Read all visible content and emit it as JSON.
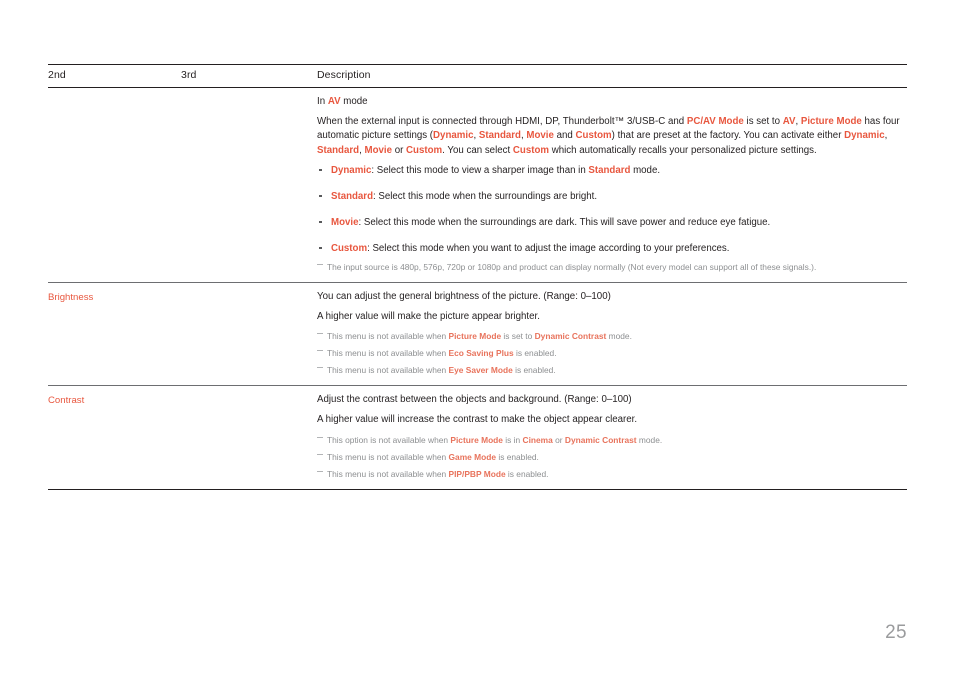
{
  "page": {
    "number": "25",
    "accent_color": "#e8573f",
    "text_color": "#231f20",
    "note_color": "#8d8f91"
  },
  "table": {
    "headers": {
      "col2": "2nd",
      "col3": "3rd",
      "description": "Description"
    },
    "rows": [
      {
        "label_2nd": "",
        "label_3rd": "",
        "paragraphs": [
          {
            "id": "av-mode-heading",
            "runs": [
              {
                "t": "In ",
                "hl": false
              },
              {
                "t": "AV",
                "hl": true
              },
              {
                "t": " mode",
                "hl": false
              }
            ]
          },
          {
            "id": "av-mode-body",
            "runs": [
              {
                "t": "When the external input is connected through HDMI, DP, Thunderbolt™ 3/USB-C and ",
                "hl": false
              },
              {
                "t": "PC/AV Mode",
                "hl": true
              },
              {
                "t": " is set to ",
                "hl": false
              },
              {
                "t": "AV",
                "hl": true
              },
              {
                "t": ", ",
                "hl": false
              },
              {
                "t": "Picture Mode",
                "hl": true
              },
              {
                "t": " has four automatic picture settings (",
                "hl": false
              },
              {
                "t": "Dynamic",
                "hl": true
              },
              {
                "t": ", ",
                "hl": false
              },
              {
                "t": "Standard",
                "hl": true
              },
              {
                "t": ", ",
                "hl": false
              },
              {
                "t": "Movie",
                "hl": true
              },
              {
                "t": " and ",
                "hl": false
              },
              {
                "t": "Custom",
                "hl": true
              },
              {
                "t": ") that are preset at the factory. You can activate either ",
                "hl": false
              },
              {
                "t": "Dynamic",
                "hl": true
              },
              {
                "t": ", ",
                "hl": false
              },
              {
                "t": "Standard",
                "hl": true
              },
              {
                "t": ", ",
                "hl": false
              },
              {
                "t": "Movie",
                "hl": true
              },
              {
                "t": " or ",
                "hl": false
              },
              {
                "t": "Custom",
                "hl": true
              },
              {
                "t": ". You can select ",
                "hl": false
              },
              {
                "t": "Custom",
                "hl": true
              },
              {
                "t": " which automatically recalls your personalized picture settings.",
                "hl": false
              }
            ]
          }
        ],
        "bullets": [
          {
            "runs": [
              {
                "t": "Dynamic",
                "hl": true
              },
              {
                "t": ": Select this mode to view a sharper image than in ",
                "hl": false
              },
              {
                "t": "Standard",
                "hl": true
              },
              {
                "t": " mode.",
                "hl": false
              }
            ]
          },
          {
            "runs": [
              {
                "t": "Standard",
                "hl": true
              },
              {
                "t": ": Select this mode when the surroundings are bright.",
                "hl": false
              }
            ]
          },
          {
            "runs": [
              {
                "t": "Movie",
                "hl": true
              },
              {
                "t": ": Select this mode when the surroundings are dark. This will save power and reduce eye fatigue.",
                "hl": false
              }
            ]
          },
          {
            "runs": [
              {
                "t": "Custom",
                "hl": true
              },
              {
                "t": ": Select this mode when you want to adjust the image according to your preferences.",
                "hl": false
              }
            ]
          }
        ],
        "notes": [
          {
            "runs": [
              {
                "t": "The input source is 480p, 576p, 720p or 1080p and product can display normally (Not every model can support all of these signals.).",
                "hl": false
              }
            ]
          }
        ]
      },
      {
        "label_2nd": "Brightness",
        "label_3rd": "",
        "paragraphs": [
          {
            "id": "brightness-range",
            "runs": [
              {
                "t": "You can adjust the general brightness of the picture. (Range: 0–100)",
                "hl": false
              }
            ]
          },
          {
            "id": "brightness-body",
            "runs": [
              {
                "t": "A higher value will make the picture appear brighter.",
                "hl": false
              }
            ]
          }
        ],
        "bullets": [],
        "notes": [
          {
            "runs": [
              {
                "t": "This menu is not available when ",
                "hl": false
              },
              {
                "t": "Picture Mode",
                "hl": true
              },
              {
                "t": " is set to ",
                "hl": false
              },
              {
                "t": "Dynamic Contrast",
                "hl": true
              },
              {
                "t": " mode.",
                "hl": false
              }
            ]
          },
          {
            "runs": [
              {
                "t": "This menu is not available when ",
                "hl": false
              },
              {
                "t": "Eco Saving Plus",
                "hl": true
              },
              {
                "t": " is enabled.",
                "hl": false
              }
            ]
          },
          {
            "runs": [
              {
                "t": "This menu is not available when ",
                "hl": false
              },
              {
                "t": "Eye Saver Mode",
                "hl": true
              },
              {
                "t": " is enabled.",
                "hl": false
              }
            ]
          }
        ]
      },
      {
        "label_2nd": "Contrast",
        "label_3rd": "",
        "paragraphs": [
          {
            "id": "contrast-range",
            "runs": [
              {
                "t": "Adjust the contrast between the objects and background. (Range: 0–100)",
                "hl": false
              }
            ]
          },
          {
            "id": "contrast-body",
            "runs": [
              {
                "t": "A higher value will increase the contrast to make the object appear clearer.",
                "hl": false
              }
            ]
          }
        ],
        "bullets": [],
        "notes": [
          {
            "runs": [
              {
                "t": "This option is not available when ",
                "hl": false
              },
              {
                "t": "Picture Mode",
                "hl": true
              },
              {
                "t": " is in ",
                "hl": false
              },
              {
                "t": "Cinema",
                "hl": true
              },
              {
                "t": " or ",
                "hl": false
              },
              {
                "t": "Dynamic Contrast",
                "hl": true
              },
              {
                "t": " mode.",
                "hl": false
              }
            ]
          },
          {
            "runs": [
              {
                "t": "This menu is not available when ",
                "hl": false
              },
              {
                "t": "Game Mode",
                "hl": true
              },
              {
                "t": " is enabled.",
                "hl": false
              }
            ]
          },
          {
            "runs": [
              {
                "t": "This menu is not available when ",
                "hl": false
              },
              {
                "t": "PIP/PBP Mode",
                "hl": true
              },
              {
                "t": " is enabled.",
                "hl": false
              }
            ]
          }
        ]
      }
    ]
  }
}
